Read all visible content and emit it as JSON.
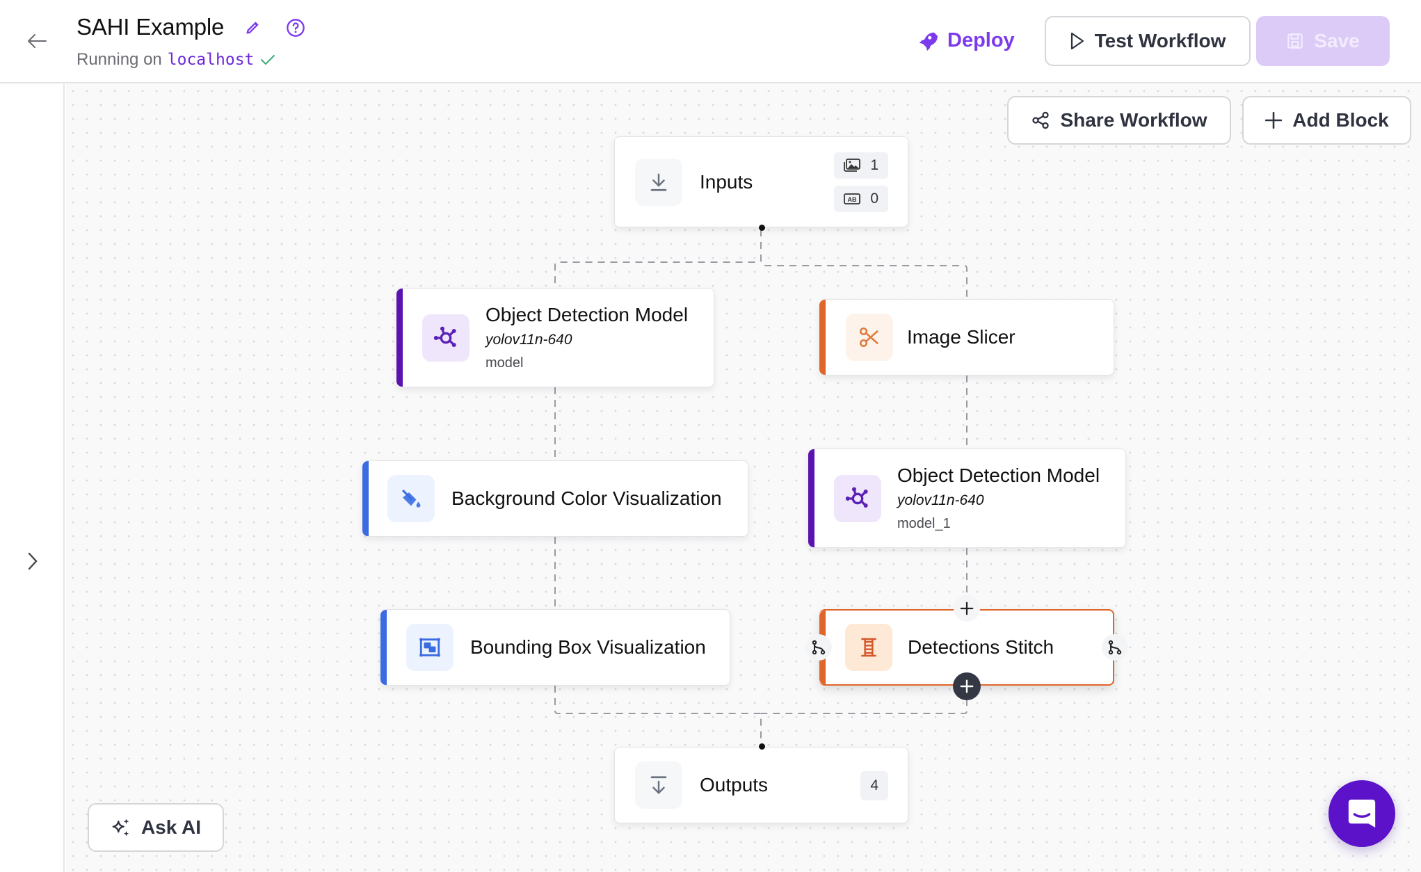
{
  "header": {
    "title": "SAHI Example",
    "status_prefix": "Running on",
    "host": "localhost",
    "deploy_label": "Deploy",
    "test_label": "Test Workflow",
    "save_label": "Save"
  },
  "canvas_toolbar": {
    "share_label": "Share Workflow",
    "add_block_label": "Add Block",
    "ask_ai_label": "Ask AI"
  },
  "nodes": {
    "inputs": {
      "label": "Inputs",
      "image_count": "1",
      "param_count": "0"
    },
    "odm1": {
      "label": "Object Detection Model",
      "model_id": "yolov11n-640",
      "name": "model"
    },
    "slicer": {
      "label": "Image Slicer"
    },
    "bgviz": {
      "label": "Background Color Visualization"
    },
    "odm2": {
      "label": "Object Detection Model",
      "model_id": "yolov11n-640",
      "name": "model_1"
    },
    "bboxviz": {
      "label": "Bounding Box Visualization"
    },
    "stitch": {
      "label": "Detections Stitch"
    },
    "outputs": {
      "label": "Outputs",
      "count": "4"
    }
  },
  "colors": {
    "brand": "#7c3aed",
    "model_accent": "#5b13b0",
    "transform_accent": "#e0652a",
    "viz_accent": "#3b6be0",
    "success": "#3aa876"
  }
}
